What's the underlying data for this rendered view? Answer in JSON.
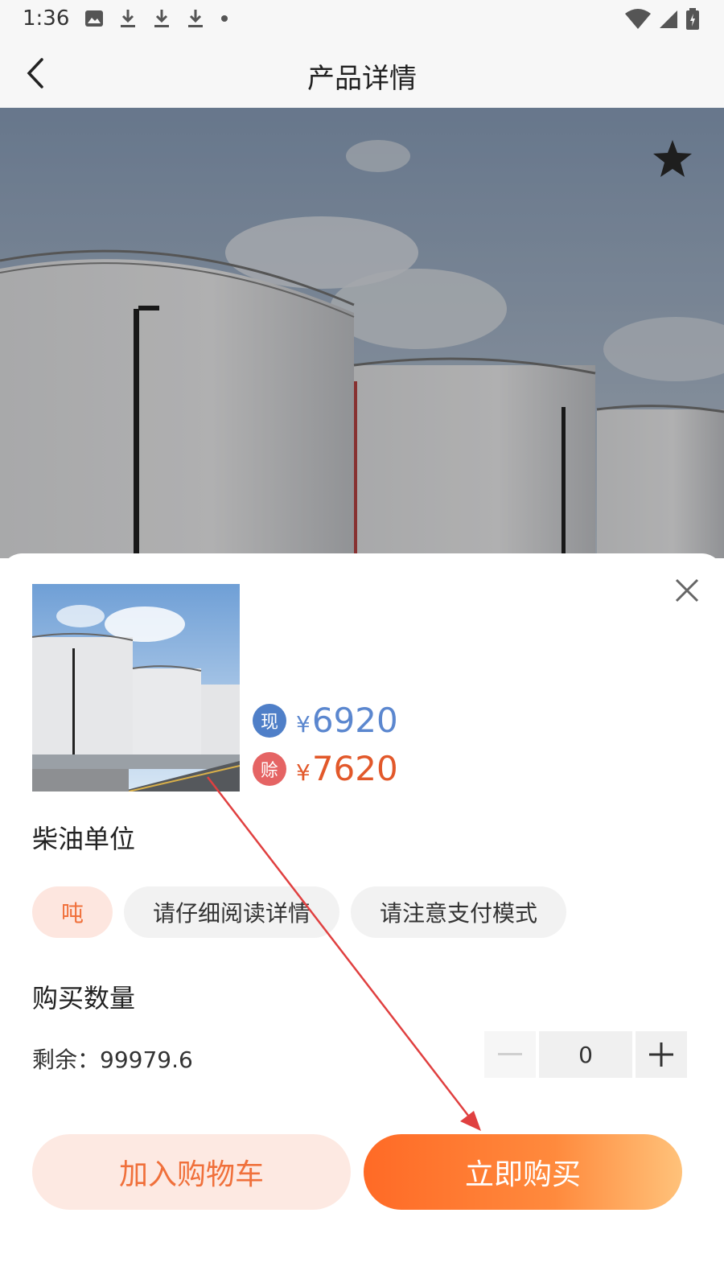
{
  "status_bar": {
    "time": "1:36"
  },
  "header": {
    "title": "产品详情"
  },
  "product": {
    "prices": [
      {
        "badge": "现",
        "currency": "¥",
        "value": "6920"
      },
      {
        "badge": "赊",
        "currency": "¥",
        "value": "7620"
      }
    ]
  },
  "unit_section": {
    "label": "柴油单位",
    "options": [
      "吨",
      "请仔细阅读详情",
      "请注意支付模式"
    ],
    "selected": "吨"
  },
  "quantity_section": {
    "label": "购买数量",
    "stock_text": "剩余：99979.6",
    "quantity": "0"
  },
  "actions": {
    "add_to_cart": "加入购物车",
    "buy_now": "立即购买"
  },
  "colors": {
    "accent": "#ff6a26",
    "cash_price": "#5b87cf",
    "credit_price": "#e2582a",
    "annotation_arrow": "#e04040"
  }
}
